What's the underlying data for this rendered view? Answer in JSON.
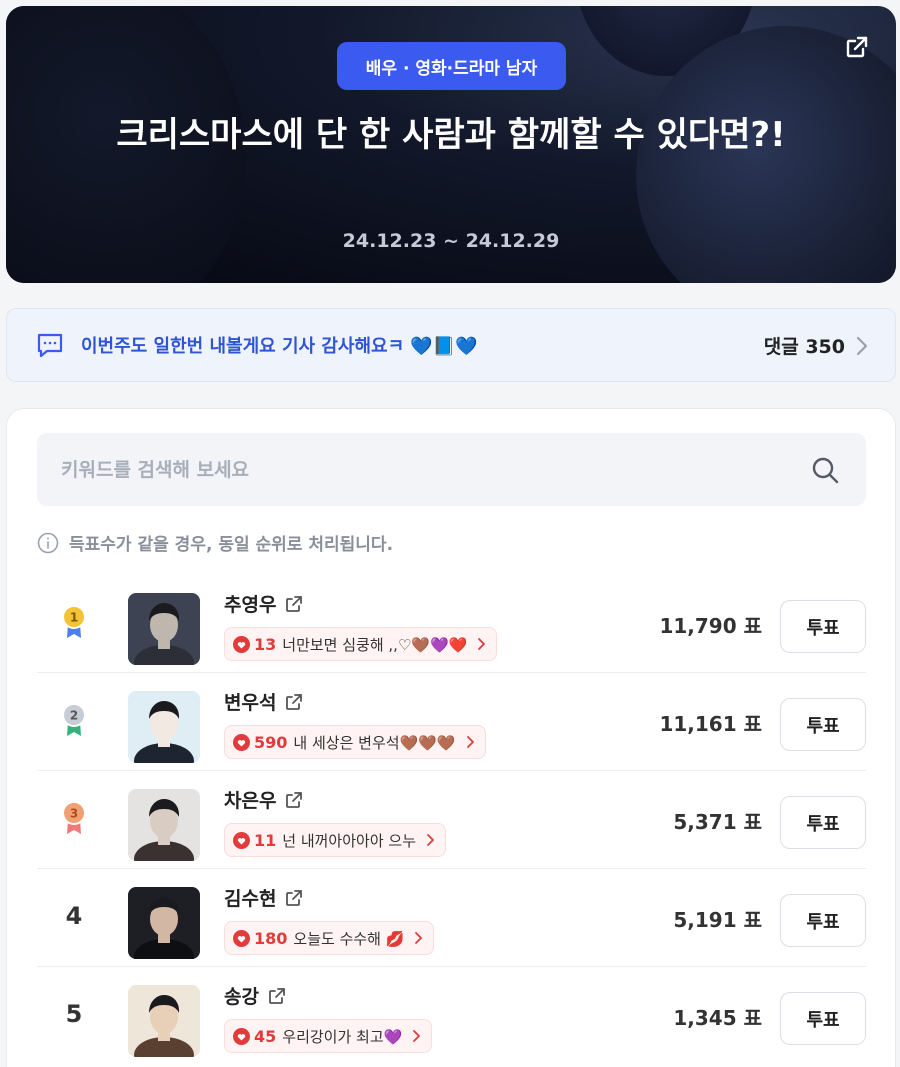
{
  "hero": {
    "category_chip": "배우 · 영화·드라마 남자",
    "title": "크리스마스에 단 한 사람과 함께할 수 있다면?!",
    "date_range": "24.12.23 ~ 24.12.29"
  },
  "notice": {
    "message": "이번주도 일한번 내볼게요 기사 감사해요ㅋ 💙📘💙",
    "comments_label": "댓글 350"
  },
  "search": {
    "placeholder": "키워드를 검색해 보세요"
  },
  "info_text": "득표수가 같을 경우, 동일 순위로 처리됩니다.",
  "vote_unit": "표",
  "vote_button_label": "투표",
  "colors": {
    "accent": "#3b5bf0",
    "heart": "#e23b3b",
    "gold": "#f2c335",
    "silver": "#c7cdd6",
    "bronze": "#f0a174",
    "ribbon_blue": "#4d7ef0",
    "ribbon_green": "#34b27a",
    "ribbon_pink": "#ef7a7a"
  },
  "ranking": [
    {
      "rank": "1",
      "medal": "gold",
      "name": "추영우",
      "cheer_count": "13",
      "cheer_text": "너만보면 심쿵해 ,,♡🤎💜❤️",
      "votes": "11,790 표"
    },
    {
      "rank": "2",
      "medal": "silver",
      "name": "변우석",
      "cheer_count": "590",
      "cheer_text": "내 세상은 변우석🤎🤎🤎",
      "votes": "11,161 표"
    },
    {
      "rank": "3",
      "medal": "bronze",
      "name": "차은우",
      "cheer_count": "11",
      "cheer_text": "넌 내꺼아아아아 으누",
      "votes": "5,371 표"
    },
    {
      "rank": "4",
      "medal": "",
      "name": "김수현",
      "cheer_count": "180",
      "cheer_text": "오늘도 수수해 💋",
      "votes": "5,191 표"
    },
    {
      "rank": "5",
      "medal": "",
      "name": "송강",
      "cheer_count": "45",
      "cheer_text": "우리강이가 최고💜",
      "votes": "1,345 표"
    }
  ]
}
